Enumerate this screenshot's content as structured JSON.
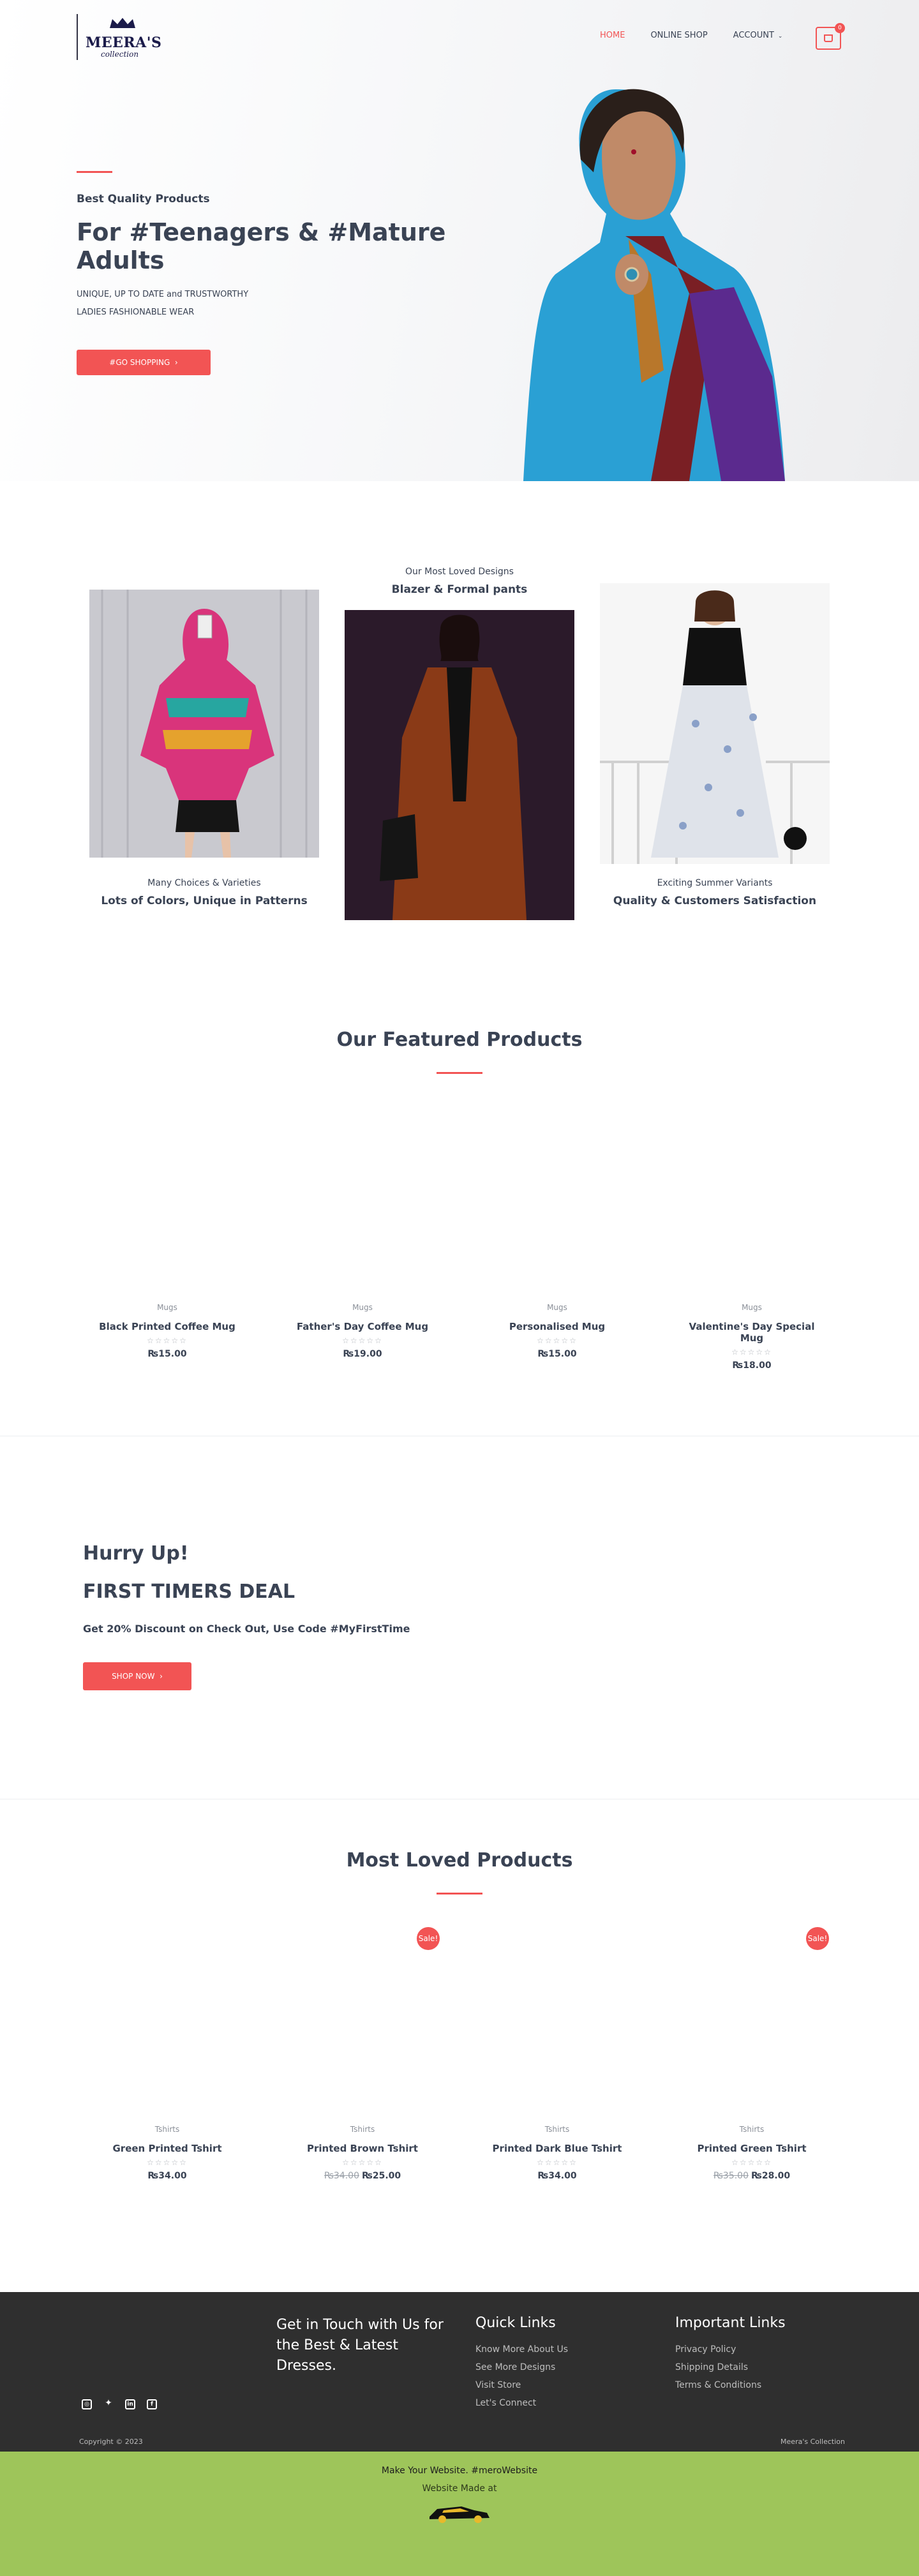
{
  "header": {
    "brand": "MEERA'S",
    "brand_sub": "collection",
    "nav": [
      {
        "label": "HOME"
      },
      {
        "label": "ONLINE SHOP"
      },
      {
        "label": "ACCOUNT"
      }
    ],
    "cart_count": "0"
  },
  "hero": {
    "eyebrow": "Best Quality Products",
    "title": "For #Teenagers & #Mature Adults",
    "description": "UNIQUE, UP TO DATE and TRUSTWORTHY LADIES FASHIONABLE WEAR",
    "button": "#GO SHOPPING"
  },
  "designs": {
    "left": {
      "eyebrow": "Many Choices & Varieties",
      "title": "Lots of Colors, Unique in Patterns"
    },
    "center": {
      "eyebrow": "Our Most Loved Designs",
      "title": "Blazer & Formal pants"
    },
    "right": {
      "eyebrow": "Exciting Summer Variants",
      "title": "Quality & Customers Satisfaction"
    }
  },
  "featured": {
    "title": "Our Featured Products",
    "products": [
      {
        "category": "Mugs",
        "name": "Black Printed Coffee Mug",
        "price": "₨15.00"
      },
      {
        "category": "Mugs",
        "name": "Father's Day Coffee Mug",
        "price": "₨19.00"
      },
      {
        "category": "Mugs",
        "name": "Personalised Mug",
        "price": "₨15.00"
      },
      {
        "category": "Mugs",
        "name": "Valentine's Day Special Mug",
        "price": "₨18.00"
      }
    ]
  },
  "deal": {
    "line1": "Hurry Up!",
    "line2": "FIRST TIMERS DEAL",
    "line3": "Get 20% Discount on Check Out, Use Code #MyFirstTime",
    "button": "SHOP NOW"
  },
  "loved": {
    "title": "Most Loved Products",
    "sale_label": "Sale!",
    "products": [
      {
        "category": "Tshirts",
        "name": "Green Printed Tshirt",
        "old_price": "",
        "price": "₨34.00"
      },
      {
        "category": "Tshirts",
        "name": "Printed Brown Tshirt",
        "old_price": "₨34.00",
        "price": "₨25.00"
      },
      {
        "category": "Tshirts",
        "name": "Printed Dark Blue Tshirt",
        "old_price": "",
        "price": "₨34.00"
      },
      {
        "category": "Tshirts",
        "name": "Printed Green Tshirt",
        "old_price": "₨35.00",
        "price": "₨28.00"
      }
    ]
  },
  "footer": {
    "touch": "Get in Touch with Us for the Best & Latest Dresses.",
    "quick_links_title": "Quick Links",
    "quick_links": [
      "Know More About Us",
      "See More Designs",
      "Visit Store",
      "Let's Connect"
    ],
    "important_title": "Important Links",
    "important_links": [
      "Privacy Policy",
      "Shipping Details",
      "Terms & Conditions"
    ],
    "copyright": "Copyright © 2023",
    "copyright_right": "Meera's Collection"
  },
  "strip": {
    "line1": "Make Your Website. #meroWebsite",
    "line2": "Website Made at"
  },
  "stars": "☆☆☆☆☆",
  "colors": {
    "accent": "#f25454",
    "text": "#3a4354",
    "footer": "#2f2f2f",
    "strip": "#9ec55a"
  }
}
